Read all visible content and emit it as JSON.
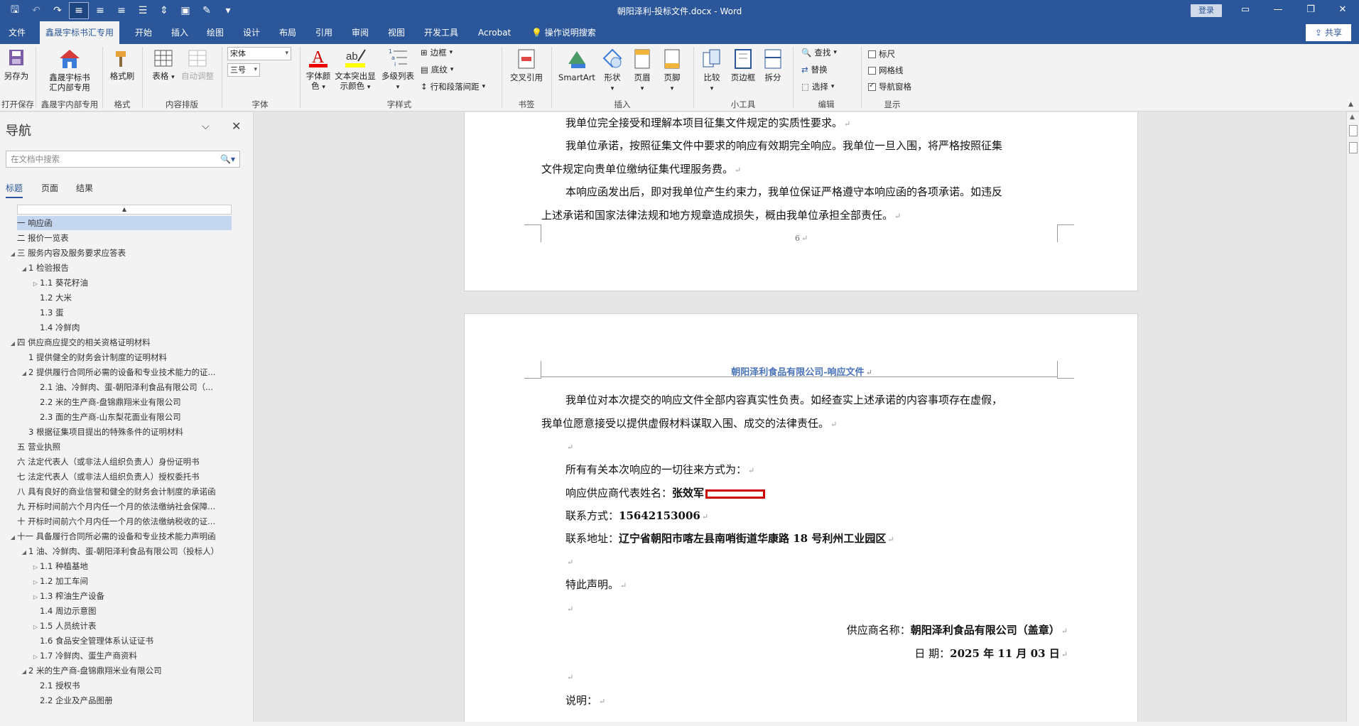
{
  "window": {
    "title": "朝阳泽利-投标文件.docx  -  Word",
    "login_label": "登录",
    "share_label": "共享"
  },
  "quick_access": [
    "save-icon",
    "undo-icon",
    "redo-icon",
    "align-left-icon",
    "align-center-icon",
    "align-right-icon",
    "justify-icon",
    "line-spacing-icon",
    "save-as-icon",
    "format-painter-icon",
    "more-icon"
  ],
  "menu_tabs": [
    "文件",
    "鑫晟宇标书汇专用",
    "开始",
    "插入",
    "绘图",
    "设计",
    "布局",
    "引用",
    "审阅",
    "视图",
    "开发工具",
    "Acrobat",
    "操作说明搜索"
  ],
  "ribbon": {
    "save_as": "另存为",
    "open_save_group": "打开保存",
    "xsy_btn_line1": "鑫晟宇标书",
    "xsy_btn_line2": "汇内部专用",
    "xsy_group": "鑫晟宇内部专用",
    "format_painter": "格式刷",
    "format_group": "格式",
    "table": "表格",
    "auto_adjust": "自动调整",
    "layout_group": "内容排版",
    "font_name": "宋体",
    "font_size": "三号",
    "font_group": "字体",
    "font_color_line1": "字体颜",
    "font_color_line2": "色",
    "highlight_line1": "文本突出显",
    "highlight_line2": "示颜色",
    "multilevel": "多级列表",
    "border": "边框",
    "shading": "底纹",
    "line_spacing": "行和段落间距",
    "style_group": "字样式",
    "cross_ref": "交叉引用",
    "bookmark_group": "书签",
    "smartart": "SmartArt",
    "shape": "形状",
    "header": "页眉",
    "footer": "页脚",
    "insert_group": "插入",
    "compare": "比较",
    "page_border": "页边框",
    "split": "拆分",
    "tools_group": "小工具",
    "find": "查找",
    "replace": "替换",
    "select": "选择",
    "edit_group": "编辑",
    "ruler": "标尺",
    "gridlines": "网格线",
    "nav_pane": "导航窗格",
    "show_group": "显示"
  },
  "nav": {
    "title": "导航",
    "search_placeholder": "在文档中搜索",
    "tabs": [
      "标题",
      "页面",
      "结果"
    ],
    "items": [
      {
        "text": "一 响应函",
        "level": 1,
        "twisty": "",
        "selected": true
      },
      {
        "text": "二 报价一览表",
        "level": 1,
        "twisty": ""
      },
      {
        "text": "三 服务内容及服务要求应答表",
        "level": 1,
        "twisty": "◢"
      },
      {
        "text": "1 检验报告",
        "level": 2,
        "twisty": "◢"
      },
      {
        "text": "1.1 葵花籽油",
        "level": 3,
        "twisty": "▷"
      },
      {
        "text": "1.2 大米",
        "level": 3,
        "twisty": ""
      },
      {
        "text": "1.3 蛋",
        "level": 3,
        "twisty": ""
      },
      {
        "text": "1.4 冷鲜肉",
        "level": 3,
        "twisty": ""
      },
      {
        "text": "四 供应商应提交的相关资格证明材料",
        "level": 1,
        "twisty": "◢"
      },
      {
        "text": "1 提供健全的财务会计制度的证明材料",
        "level": 2,
        "twisty": ""
      },
      {
        "text": "2 提供履行合同所必需的设备和专业技术能力的证...",
        "level": 2,
        "twisty": "◢"
      },
      {
        "text": "2.1 油、冷鲜肉、蛋-朝阳泽利食品有限公司（...",
        "level": 3,
        "twisty": ""
      },
      {
        "text": "2.2 米的生产商-盘锦鼎翔米业有限公司",
        "level": 3,
        "twisty": ""
      },
      {
        "text": "2.3 面的生产商-山东梨花面业有限公司",
        "level": 3,
        "twisty": ""
      },
      {
        "text": "3 根据征集项目提出的特殊条件的证明材料",
        "level": 2,
        "twisty": ""
      },
      {
        "text": "五 营业执照",
        "level": 1,
        "twisty": ""
      },
      {
        "text": "六 法定代表人（或非法人组织负责人）身份证明书",
        "level": 1,
        "twisty": ""
      },
      {
        "text": "七 法定代表人（或非法人组织负责人）授权委托书",
        "level": 1,
        "twisty": ""
      },
      {
        "text": "八 具有良好的商业信誉和健全的财务会计制度的承诺函",
        "level": 1,
        "twisty": ""
      },
      {
        "text": "九 开标时间前六个月内任一个月的依法缴纳社会保障...",
        "level": 1,
        "twisty": ""
      },
      {
        "text": "十 开标时间前六个月内任一个月的依法缴纳税收的证...",
        "level": 1,
        "twisty": ""
      },
      {
        "text": "十一 具备履行合同所必需的设备和专业技术能力声明函",
        "level": 1,
        "twisty": "◢"
      },
      {
        "text": "1 油、冷鲜肉、蛋-朝阳泽利食品有限公司（投标人）",
        "level": 2,
        "twisty": "◢"
      },
      {
        "text": "1.1 种植基地",
        "level": 3,
        "twisty": "▷"
      },
      {
        "text": "1.2 加工车间",
        "level": 3,
        "twisty": "▷"
      },
      {
        "text": "1.3 榨油生产设备",
        "level": 3,
        "twisty": "▷"
      },
      {
        "text": "1.4 周边示意图",
        "level": 3,
        "twisty": ""
      },
      {
        "text": "1.5 人员统计表",
        "level": 3,
        "twisty": "▷"
      },
      {
        "text": "1.6 食品安全管理体系认证证书",
        "level": 3,
        "twisty": ""
      },
      {
        "text": "1.7 冷鲜肉、蛋生产商资料",
        "level": 3,
        "twisty": "▷"
      },
      {
        "text": "2 米的生产商-盘锦鼎翔米业有限公司",
        "level": 2,
        "twisty": "◢"
      },
      {
        "text": "2.1 授权书",
        "level": 3,
        "twisty": ""
      },
      {
        "text": "2.2 企业及产品图册",
        "level": 3,
        "twisty": ""
      }
    ]
  },
  "document": {
    "page1": {
      "lines": [
        "我单位完全接受和理解本项目征集文件规定的实质性要求。",
        "我单位承诺，按照征集文件中要求的响应有效期完全响应。我单位一旦入围，将严格按照征集",
        "文件规定向贵单位缴纳征集代理服务费。",
        "本响应函发出后，即对我单位产生约束力，我单位保证严格遵守本响应函的各项承诺。如违反",
        "上述承诺和国家法律法规和地方规章造成损失，概由我单位承担全部责任。"
      ],
      "page_number": "6"
    },
    "page2": {
      "header": "朝阳泽利食品有限公司-响应文件",
      "line1": "我单位对本次提交的响应文件全部内容真实性负责。如经查实上述承诺的内容事项存在虚假，",
      "line2": "我单位愿意接受以提供虚假材料谋取入围、成交的法律责任。",
      "contact_intro": "所有有关本次响应的一切往来方式为：",
      "rep_label": "响应供应商代表姓名：",
      "rep_name": "张效军",
      "phone_label": "联系方式：",
      "phone": "15642153006",
      "addr_label": "联系地址：",
      "addr": "辽宁省朝阳市喀左县南哨街道华康路 18 号利州工业园区",
      "hereby": "特此声明。",
      "supplier_label": "供应商名称：",
      "supplier": "朝阳泽利食品有限公司（盖章）",
      "date_label": "日  期：",
      "date": "2025 年 11 月 03 日",
      "note": "说明："
    }
  },
  "colors": {
    "brand": "#2b579a",
    "selection": "#c5d7f0",
    "header_text": "#4a73b8"
  }
}
